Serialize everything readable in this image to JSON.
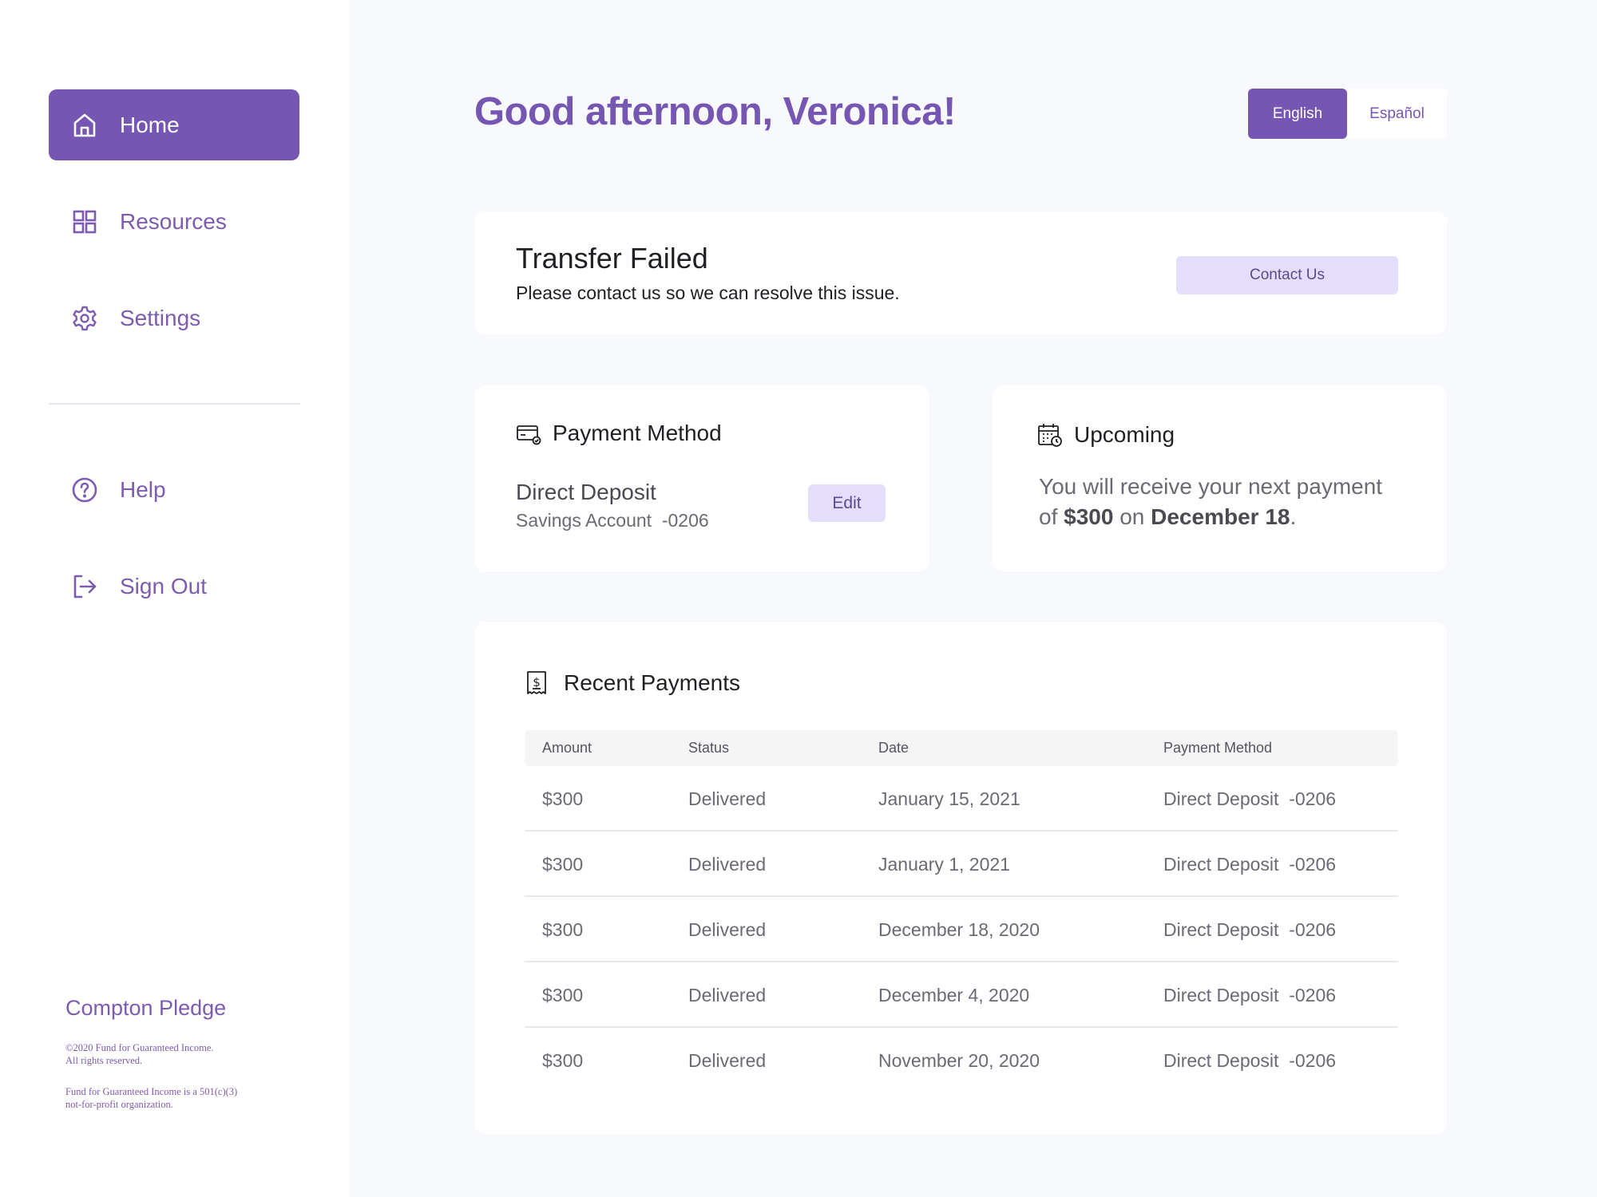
{
  "sidebar": {
    "nav": [
      {
        "label": "Home",
        "icon": "home-icon",
        "active": true
      },
      {
        "label": "Resources",
        "icon": "grid-icon",
        "active": false
      },
      {
        "label": "Settings",
        "icon": "gear-icon",
        "active": false
      }
    ],
    "secondary": [
      {
        "label": "Help",
        "icon": "help-icon"
      },
      {
        "label": "Sign Out",
        "icon": "sign-out-icon"
      }
    ],
    "brand": "Compton Pledge",
    "copyright_line1": "©2020 Fund for Guaranteed Income.",
    "copyright_line2": "All rights reserved.",
    "nonprofit_line1": "Fund for Guaranteed Income is a 501(c)(3)",
    "nonprofit_line2": "not-for-profit organization."
  },
  "header": {
    "greeting": "Good afternoon, Veronica!",
    "languages": [
      {
        "label": "English",
        "active": true
      },
      {
        "label": "Español",
        "active": false
      }
    ]
  },
  "alert": {
    "title": "Transfer Failed",
    "message": "Please contact us so we can resolve this issue.",
    "button": "Contact Us"
  },
  "payment_method": {
    "title": "Payment Method",
    "name": "Direct Deposit",
    "account": "Savings Account  -0206",
    "edit_button": "Edit"
  },
  "upcoming": {
    "title": "Upcoming",
    "text_prefix": "You will receive your next payment of ",
    "amount": "$300",
    "text_mid": " on ",
    "date": "December 18",
    "text_suffix": "."
  },
  "recent_payments": {
    "title": "Recent Payments",
    "columns": [
      "Amount",
      "Status",
      "Date",
      "Payment Method"
    ],
    "rows": [
      {
        "amount": "$300",
        "status": "Delivered",
        "date": "January 15, 2021",
        "method": "Direct Deposit  -0206"
      },
      {
        "amount": "$300",
        "status": "Delivered",
        "date": "January 1, 2021",
        "method": "Direct Deposit  -0206"
      },
      {
        "amount": "$300",
        "status": "Delivered",
        "date": "December 18, 2020",
        "method": "Direct Deposit  -0206"
      },
      {
        "amount": "$300",
        "status": "Delivered",
        "date": "December 4, 2020",
        "method": "Direct Deposit  -0206"
      },
      {
        "amount": "$300",
        "status": "Delivered",
        "date": "November 20, 2020",
        "method": "Direct Deposit  -0206"
      }
    ]
  },
  "colors": {
    "accent": "#7656b3",
    "soft_button": "#e4ddfb",
    "background": "#f8f9fc"
  }
}
